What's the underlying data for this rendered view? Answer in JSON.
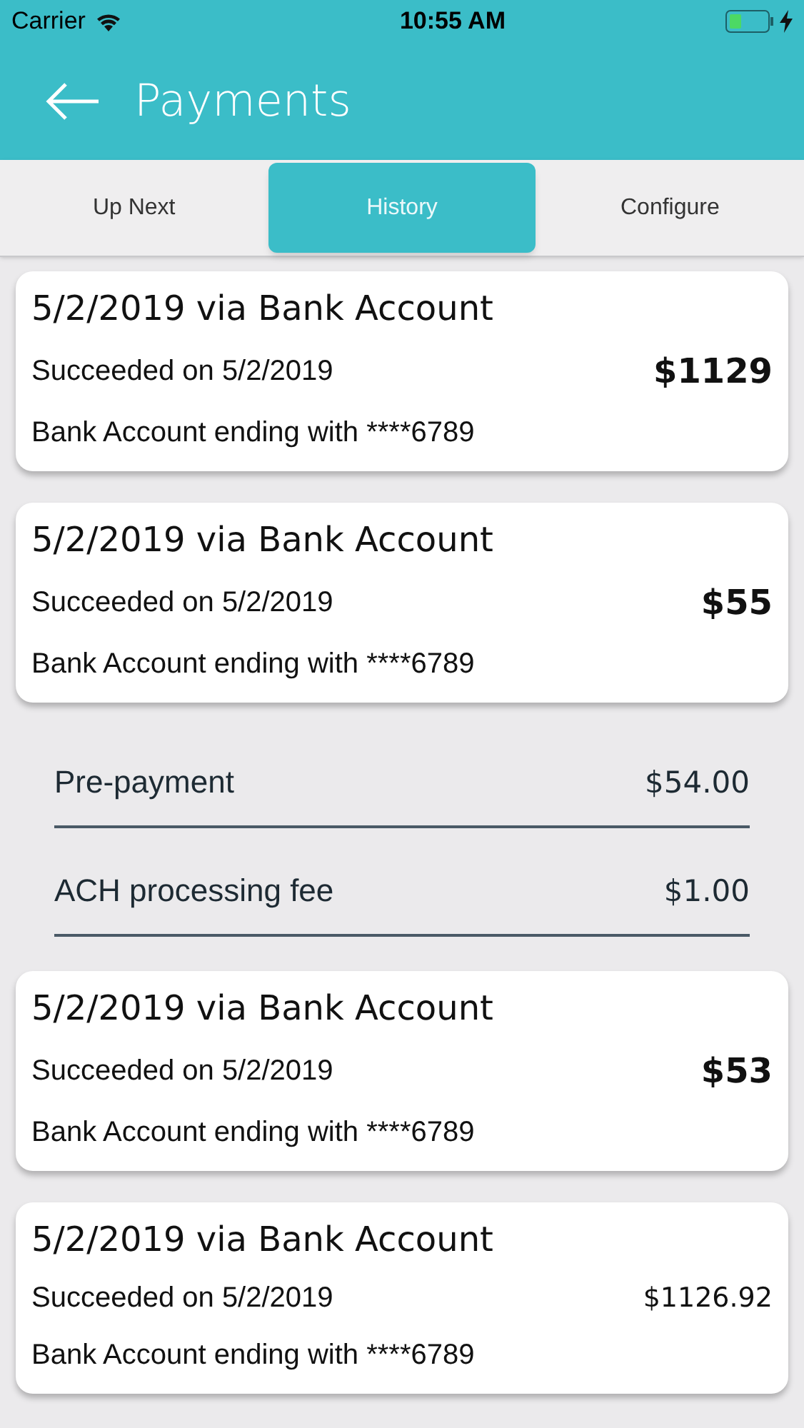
{
  "status_bar": {
    "carrier": "Carrier",
    "time": "10:55 AM"
  },
  "header": {
    "title": "Payments"
  },
  "tabs": [
    {
      "label": "Up Next",
      "selected": false
    },
    {
      "label": "History",
      "selected": true
    },
    {
      "label": "Configure",
      "selected": false
    }
  ],
  "payments": [
    {
      "title": "5/2/2019 via Bank Account",
      "status": "Succeeded on 5/2/2019",
      "amount": "$1129",
      "account": "Bank Account ending with ****6789"
    },
    {
      "title": "5/2/2019 via Bank Account",
      "status": "Succeeded on 5/2/2019",
      "amount": "$55",
      "account": "Bank Account ending with ****6789",
      "breakdown": [
        {
          "label": "Pre-payment",
          "amount": "$54.00"
        },
        {
          "label": "ACH processing fee",
          "amount": "$1.00"
        }
      ]
    },
    {
      "title": "5/2/2019 via Bank Account",
      "status": "Succeeded on 5/2/2019",
      "amount": "$53",
      "account": "Bank Account ending with ****6789"
    },
    {
      "title": "5/2/2019 via Bank Account",
      "status": "Succeeded on 5/2/2019",
      "amount": "$1126.92",
      "account": "Bank Account ending with ****6789"
    }
  ]
}
